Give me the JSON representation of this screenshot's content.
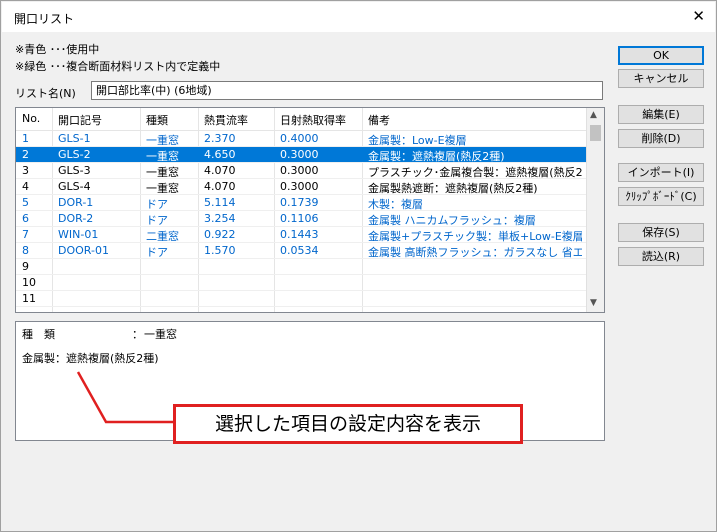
{
  "window": {
    "title": "開口リスト",
    "close_glyph": "✕"
  },
  "notes": [
    "※青色 ･･･使用中",
    "※緑色 ･･･複合断面材料リスト内で定義中"
  ],
  "list_name": {
    "label": "リスト名(N)",
    "value": "開口部比率(中) (6地域)"
  },
  "table": {
    "headers": [
      "No.",
      "開口記号",
      "種類",
      "熱貫流率",
      "日射熱取得率",
      "備考"
    ],
    "rows": [
      {
        "no": "1",
        "code": "GLS-1",
        "type": "一重窓",
        "u": "2.370",
        "eta": "0.4000",
        "note": "金属製：Low-E複層"
      },
      {
        "no": "2",
        "code": "GLS-2",
        "type": "一重窓",
        "u": "4.650",
        "eta": "0.3000",
        "note": "金属製：遮熱複層(熱反2種)"
      },
      {
        "no": "3",
        "code": "GLS-3",
        "type": "一重窓",
        "u": "4.070",
        "eta": "0.3000",
        "note": "プラスチック･金属複合製：遮熱複層(熱反2"
      },
      {
        "no": "4",
        "code": "GLS-4",
        "type": "一重窓",
        "u": "4.070",
        "eta": "0.3000",
        "note": "金属製熱遮断：遮熱複層(熱反2種)"
      },
      {
        "no": "5",
        "code": "DOR-1",
        "type": "ドア",
        "u": "5.114",
        "eta": "0.1739",
        "note": "木製：複層"
      },
      {
        "no": "6",
        "code": "DOR-2",
        "type": "ドア",
        "u": "3.254",
        "eta": "0.1106",
        "note": "金属製 ハニカムフラッシュ：複層"
      },
      {
        "no": "7",
        "code": "WIN-01",
        "type": "二重窓",
        "u": "0.922",
        "eta": "0.1443",
        "note": "金属製+プラスチック製：単板+Low-E複層 ..."
      },
      {
        "no": "8",
        "code": "DOOR-01",
        "type": "ドア",
        "u": "1.570",
        "eta": "0.0534",
        "note": "金属製 高断熱フラッシュ：ガラスなし 省エ..."
      },
      {
        "no": "9",
        "code": "",
        "type": "",
        "u": "",
        "eta": "",
        "note": ""
      },
      {
        "no": "10",
        "code": "",
        "type": "",
        "u": "",
        "eta": "",
        "note": ""
      },
      {
        "no": "11",
        "code": "",
        "type": "",
        "u": "",
        "eta": "",
        "note": ""
      }
    ]
  },
  "detail": {
    "type_label": "種　類",
    "type_sep": "：",
    "type_value": "一重窓",
    "description": "金属製：遮熱複層(熱反2種)"
  },
  "buttons": {
    "ok": "OK",
    "cancel": "キャンセル",
    "edit": "編集(E)",
    "delete": "削除(D)",
    "import": "インポート(I)",
    "clipboard": "ｸﾘｯﾌﾟﾎﾞｰﾄﾞ(C)",
    "save": "保存(S)",
    "load": "読込(R)"
  },
  "callout": {
    "text": "選択した項目の設定内容を表示"
  },
  "colors": {
    "in_use": "#0066cc",
    "selected": "#0078d7",
    "callout_border": "#e02020"
  }
}
